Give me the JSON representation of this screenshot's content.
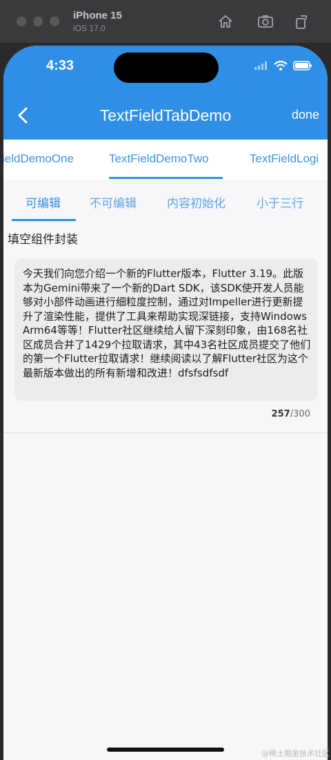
{
  "simulator": {
    "device": "iPhone 15",
    "os": "iOS 17.0"
  },
  "status_bar": {
    "time": "4:33"
  },
  "app_bar": {
    "title": "TextFieldTabDemo",
    "done_label": "done"
  },
  "top_tabs": [
    {
      "label": "ieldDemoOne",
      "active": false
    },
    {
      "label": "TextFieldDemoTwo",
      "active": true
    },
    {
      "label": "TextFieldLogi",
      "active": false
    }
  ],
  "sub_tabs": [
    {
      "label": "可编辑",
      "active": true
    },
    {
      "label": "不可编辑",
      "active": false
    },
    {
      "label": "内容初始化",
      "active": false
    },
    {
      "label": "小于三行",
      "active": false
    }
  ],
  "section_title": "填空组件封装",
  "text_field": {
    "value": "今天我们向您介绍一个新的Flutter版本，Flutter 3.19。此版本为Gemini带来了一个新的Dart SDK，该SDK使开发人员能够对小部件动画进行细粒度控制，通过对Impeller进行更新提升了渲染性能，提供了工具来帮助实现深链接，支持Windows Arm64等等！Flutter社区继续给人留下深刻印象，由168名社区成员合并了1429个拉取请求，其中43名社区成员提交了他们的第一个Flutter拉取请求！继续阅读以了解Flutter社区为这个最新版本做出的所有新增和改进！dfsfsdfsdf",
    "count": "257",
    "max": "/300"
  },
  "watermark": "@稀土掘金技术社区",
  "colors": {
    "primary": "#2f8fe6",
    "background": "#f7f7f9",
    "field_background": "#ececee"
  },
  "icons": [
    "home-icon",
    "screenshot-icon",
    "rotate-icon",
    "back-chevron-icon",
    "wifi-icon",
    "battery-icon",
    "signal-icon"
  ]
}
